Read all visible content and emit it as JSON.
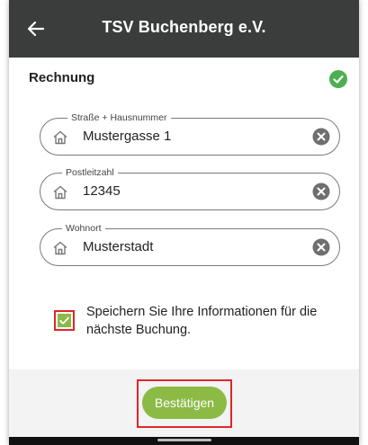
{
  "appbar": {
    "title": "TSV Buchenberg e.V.",
    "back_icon": "arrow-left-icon"
  },
  "section": {
    "title": "Rechnung",
    "status_icon": "check-circle-icon",
    "status_color": "#4caf50"
  },
  "fields": [
    {
      "label": "Straße + Hausnummer",
      "value": "Mustergasse 1"
    },
    {
      "label": "Postleitzahl",
      "value": "12345"
    },
    {
      "label": "Wohnort",
      "value": "Musterstadt"
    }
  ],
  "save_info": {
    "checked": true,
    "text": "Speichern Sie Ihre Informationen für die nächste Buchung."
  },
  "footer": {
    "confirm_label": "Bestätigen"
  },
  "colors": {
    "appbar": "#3b3d3d",
    "accent": "#8bba45",
    "highlight": "#e0262a"
  }
}
